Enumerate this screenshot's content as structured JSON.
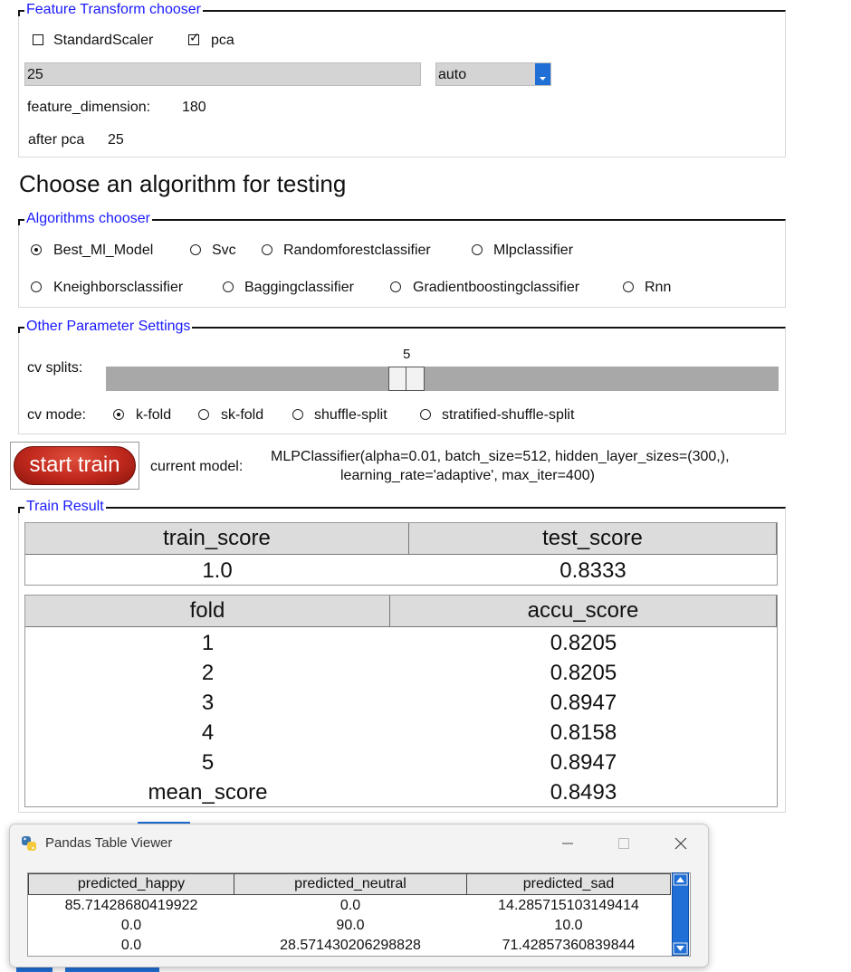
{
  "feature_transform": {
    "legend": "Feature Transform chooser",
    "standard_scaler_label": "StandardScaler",
    "standard_scaler_checked": false,
    "pca_label": "pca",
    "pca_checked": true,
    "components_value": "25",
    "solver_value": "auto",
    "feature_dimension_label": "feature_dimension:",
    "feature_dimension_value": "180",
    "after_pca_label": "after pca",
    "after_pca_value": "25"
  },
  "heading": "Choose an algorithm for testing",
  "algorithms": {
    "legend": "Algorithms chooser",
    "options": [
      "Best_Ml_Model",
      "Svc",
      "Randomforestclassifier",
      "Mlpclassifier",
      "Kneighborsclassifier",
      "Baggingclassifier",
      "Gradientboostingclassifier",
      "Rnn"
    ],
    "selected": "Best_Ml_Model"
  },
  "other_params": {
    "legend": "Other Parameter Settings",
    "cv_splits_label": "cv splits:",
    "cv_splits_value": "5",
    "cv_mode_label": "cv mode:",
    "cv_modes": [
      "k-fold",
      "sk-fold",
      "shuffle-split",
      "stratified-shuffle-split"
    ],
    "cv_mode_selected": "k-fold"
  },
  "train": {
    "button_label": "start train",
    "current_model_label": "current model:",
    "current_model_line1": "MLPClassifier(alpha=0.01, batch_size=512, hidden_layer_sizes=(300,),",
    "current_model_line2": "learning_rate='adaptive', max_iter=400)"
  },
  "train_result": {
    "legend": "Train Result",
    "score_headers": [
      "train_score",
      "test_score"
    ],
    "score_values": [
      "1.0",
      "0.8333"
    ],
    "fold_headers": [
      "fold",
      "accu_score"
    ],
    "fold_rows": [
      [
        "1",
        "0.8205"
      ],
      [
        "2",
        "0.8205"
      ],
      [
        "3",
        "0.8947"
      ],
      [
        "4",
        "0.8158"
      ],
      [
        "5",
        "0.8947"
      ],
      [
        "mean_score",
        "0.8493"
      ]
    ]
  },
  "viewer": {
    "title": "Pandas Table Viewer",
    "columns": [
      "predicted_happy",
      "predicted_neutral",
      "predicted_sad"
    ],
    "rows": [
      [
        "85.71428680419922",
        "0.0",
        "14.285715103149414"
      ],
      [
        "0.0",
        "90.0",
        "10.0"
      ],
      [
        "0.0",
        "28.571430206298828",
        "71.42857360839844"
      ]
    ]
  },
  "colors": {
    "legend_blue": "#1a1aff",
    "button_red": "#c0281c",
    "scroll_blue": "#1f6fd6"
  }
}
